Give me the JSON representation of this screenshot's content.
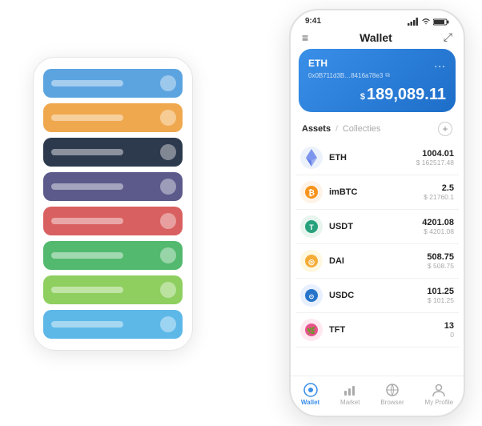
{
  "app": {
    "title": "Wallet"
  },
  "status_bar": {
    "time": "9:41",
    "signal": "●●●",
    "wifi": "WiFi",
    "battery": "Battery"
  },
  "nav": {
    "menu_icon": "≡",
    "title": "Wallet",
    "expand_icon": "⤢"
  },
  "wallet_card": {
    "currency": "ETH",
    "address": "0x0B711d3B…8416a78e3",
    "copy_icon": "⧉",
    "balance_prefix": "$",
    "balance": "189,089.11",
    "more_icon": "..."
  },
  "assets": {
    "tab_active": "Assets",
    "tab_divider": "/",
    "tab_inactive": "Collecties",
    "add_icon": "+"
  },
  "asset_list": [
    {
      "name": "ETH",
      "icon": "◈",
      "icon_class": "asset-icon-eth",
      "amount": "1004.01",
      "usd": "$ 162517.48"
    },
    {
      "name": "imBTC",
      "icon": "₿",
      "icon_class": "asset-icon-imbtc",
      "amount": "2.5",
      "usd": "$ 21760.1"
    },
    {
      "name": "USDT",
      "icon": "₮",
      "icon_class": "asset-icon-usdt",
      "amount": "4201.08",
      "usd": "$ 4201.08"
    },
    {
      "name": "DAI",
      "icon": "◎",
      "icon_class": "asset-icon-dai",
      "amount": "508.75",
      "usd": "$ 508.75"
    },
    {
      "name": "USDC",
      "icon": "⊙",
      "icon_class": "asset-icon-usdc",
      "amount": "101.25",
      "usd": "$ 101.25"
    },
    {
      "name": "TFT",
      "icon": "🌿",
      "icon_class": "asset-icon-tft",
      "amount": "13",
      "usd": "0"
    }
  ],
  "bottom_nav": [
    {
      "label": "Wallet",
      "icon": "◎",
      "active": true
    },
    {
      "label": "Market",
      "icon": "📊",
      "active": false
    },
    {
      "label": "Browser",
      "icon": "🌐",
      "active": false
    },
    {
      "label": "My Profile",
      "icon": "👤",
      "active": false
    }
  ],
  "card_stack": [
    {
      "color": "card-blue",
      "label": ""
    },
    {
      "color": "card-orange",
      "label": ""
    },
    {
      "color": "card-dark",
      "label": ""
    },
    {
      "color": "card-purple",
      "label": ""
    },
    {
      "color": "card-red",
      "label": ""
    },
    {
      "color": "card-green",
      "label": ""
    },
    {
      "color": "card-lightgreen",
      "label": ""
    },
    {
      "color": "card-lightblue",
      "label": ""
    }
  ]
}
